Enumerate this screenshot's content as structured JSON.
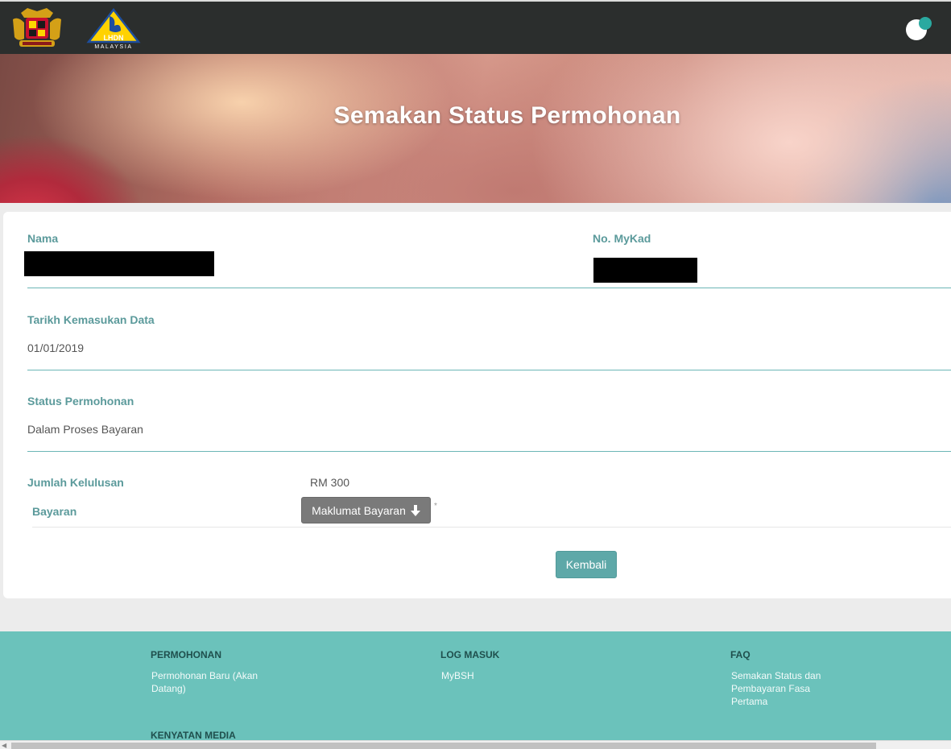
{
  "header": {
    "logo_crest_icon": "malaysia-coat-of-arms-icon",
    "logo_lhdn_icon": "lhdn-logo-icon",
    "lhdn_logo_text": "LHDN",
    "lhdn_logo_subtext": "MALAYSIA",
    "toggle_icon": "toggle-icon"
  },
  "hero": {
    "title": "Semakan Status Permohonan"
  },
  "details": {
    "name_label": "Nama",
    "mykad_label": "No. MyKad",
    "date_label": "Tarikh Kemasukan Data",
    "date_value": "01/01/2019",
    "status_label": "Status Permohonan",
    "status_value": "Dalam Proses Bayaran",
    "amount_label": "Jumlah Kelulusan",
    "amount_value": "RM 300",
    "payment_label": "Bayaran",
    "payment_button": "Maklumat Bayaran",
    "payment_button_icon": "arrow-down-icon",
    "asterisk": "*",
    "back_button": "Kembali"
  },
  "footer": {
    "columns": [
      {
        "heading": "PERMOHONAN",
        "links": [
          "Permohonan Baru (Akan",
          "Datang)"
        ]
      },
      {
        "heading": "LOG MASUK",
        "links": [
          "MyBSH"
        ]
      },
      {
        "heading": "FAQ",
        "links": [
          "Semakan Status dan",
          "Pembayaran Fasa",
          "Pertama"
        ]
      }
    ],
    "second_row_heading": "KENYATAN MEDIA"
  },
  "colors": {
    "accent": "#5ea8a8",
    "label": "#5b9a9b",
    "footer_bg": "#6bc2bb",
    "topbar_bg": "#2b2e2d"
  }
}
